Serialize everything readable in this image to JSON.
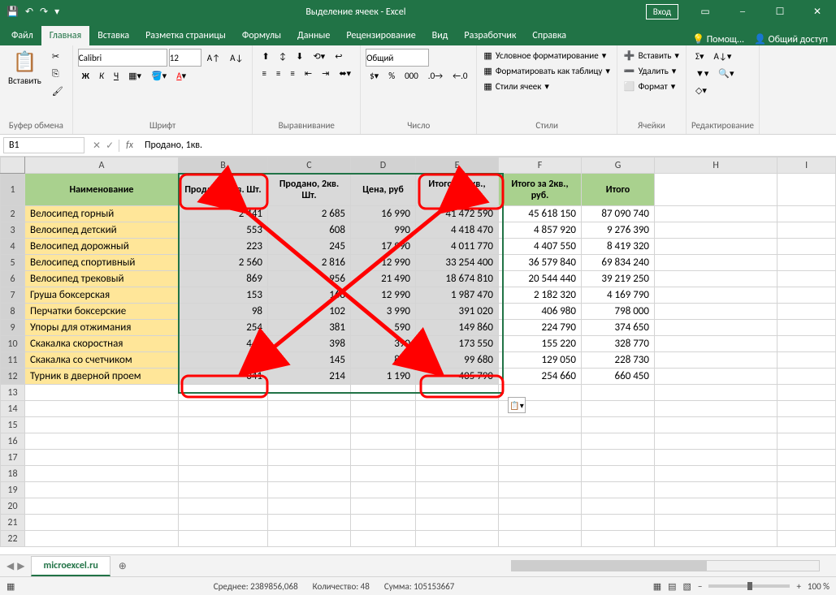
{
  "title": "Выделение ячеек - Excel",
  "login": "Вход",
  "qat": {
    "save": "💾",
    "undo": "↶",
    "redo": "↷"
  },
  "tabs": [
    "Файл",
    "Главная",
    "Вставка",
    "Разметка страницы",
    "Формулы",
    "Данные",
    "Рецензирование",
    "Вид",
    "Разработчик",
    "Справка"
  ],
  "activeTab": 1,
  "help": "Помощ...",
  "share": "Общий доступ",
  "ribbon": {
    "clipboard": {
      "paste": "Вставить",
      "label": "Буфер обмена"
    },
    "font": {
      "name": "Calibri",
      "size": "12",
      "label": "Шрифт",
      "bold": "Ж",
      "italic": "К",
      "underline": "Ч"
    },
    "align": {
      "label": "Выравнивание"
    },
    "number": {
      "format": "Общий",
      "label": "Число"
    },
    "styles": {
      "cond": "Условное форматирование",
      "table": "Форматировать как таблицу",
      "cell": "Стили ячеек",
      "label": "Стили"
    },
    "cells": {
      "insert": "Вставить",
      "delete": "Удалить",
      "format": "Формат",
      "label": "Ячейки"
    },
    "edit": {
      "label": "Редактирование"
    }
  },
  "namebox": "B1",
  "formula": "Продано, 1кв.",
  "cols": [
    "A",
    "B",
    "C",
    "D",
    "E",
    "F",
    "G",
    "H",
    "I"
  ],
  "headers": [
    "Наименование",
    "Продано, 1кв. Шт.",
    "Продано, 2кв. Шт.",
    "Цена, руб",
    "Итого за 1кв., руб.",
    "Итого за 2кв., руб.",
    "Итого"
  ],
  "rows": [
    {
      "n": "Велосипед горный",
      "b": "2 441",
      "c": "2 685",
      "d": "16 990",
      "e": "41 472 590",
      "f": "45 618 150",
      "g": "87 090 740"
    },
    {
      "n": "Велосипед детский",
      "b": "553",
      "c": "608",
      "d": "990",
      "e": "4 418 470",
      "f": "4 857 920",
      "g": "9 276 390"
    },
    {
      "n": "Велосипед дорожный",
      "b": "223",
      "c": "245",
      "d": "17 990",
      "e": "4 011 770",
      "f": "4 407 550",
      "g": "8 419 320"
    },
    {
      "n": "Велосипед спортивный",
      "b": "2 560",
      "c": "2 816",
      "d": "12 990",
      "e": "33 254 400",
      "f": "36 579 840",
      "g": "69 834 240"
    },
    {
      "n": "Велосипед трековый",
      "b": "869",
      "c": "956",
      "d": "21 490",
      "e": "18 674 810",
      "f": "20 544 440",
      "g": "39 219 250"
    },
    {
      "n": "Груша боксерская",
      "b": "153",
      "c": "168",
      "d": "12 990",
      "e": "1 987 470",
      "f": "2 182 320",
      "g": "4 169 790"
    },
    {
      "n": "Перчатки боксерские",
      "b": "98",
      "c": "102",
      "d": "3 990",
      "e": "391 020",
      "f": "406 980",
      "g": "798 000"
    },
    {
      "n": "Упоры для отжимания",
      "b": "254",
      "c": "381",
      "d": "590",
      "e": "149 860",
      "f": "224 790",
      "g": "374 650"
    },
    {
      "n": "Скакалка скоростная",
      "b": "445",
      "c": "398",
      "d": "390",
      "e": "173 550",
      "f": "155 220",
      "g": "328 770"
    },
    {
      "n": "Скакалка со счетчиком",
      "b": "112",
      "c": "145",
      "d": "890",
      "e": "99 680",
      "f": "129 050",
      "g": "228 730"
    },
    {
      "n": "Турник в дверной проем",
      "b": "341",
      "c": "214",
      "d": "1 190",
      "e": "405 790",
      "f": "254 660",
      "g": "660 450"
    }
  ],
  "sheet": "microexcel.ru",
  "status": {
    "avg": "Среднее: 2389856,068",
    "count": "Количество: 48",
    "sum": "Сумма: 105153667",
    "zoom": "100 %"
  }
}
